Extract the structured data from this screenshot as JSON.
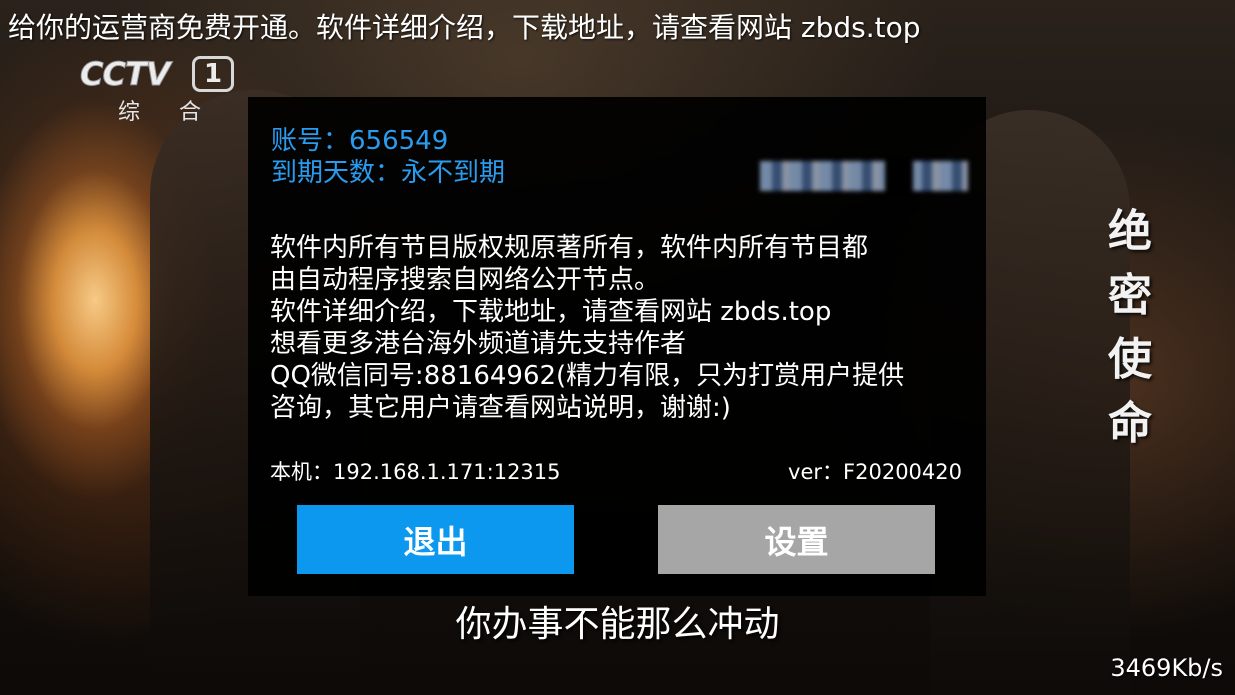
{
  "ticker": {
    "text": "给你的运营商免费开通。软件详细介绍，下载地址，请查看网站 zbds.top"
  },
  "channel_logo": {
    "brand": "CCTV",
    "number": "1",
    "name": "综 合"
  },
  "drama_title": [
    "绝",
    "密",
    "使",
    "命"
  ],
  "subtitle": "你办事不能那么冲动",
  "network_speed": "3469Kb/s",
  "dialog": {
    "account_line": "账号：656549",
    "expiry_line": "到期天数：永不到期",
    "notice_lines": [
      "软件内所有节目版权规原著所有，软件内所有节目都",
      "由自动程序搜索自网络公开节点。",
      "软件详细介绍，下载地址，请查看网站 zbds.top",
      "想看更多港台海外频道请先支持作者",
      "QQ微信同号:88164962(精力有限，只为打赏用户提供",
      "咨询，其它用户请查看网站说明，谢谢:)"
    ],
    "host_line": "本机：192.168.1.171:12315",
    "version_line": "ver：F20200420",
    "exit_label": "退出",
    "settings_label": "设置"
  },
  "colors": {
    "account_text": "#2a9cf0",
    "exit_button": "#0d98f0",
    "settings_button": "#a6a6a6",
    "dialog_background": "#000000"
  }
}
